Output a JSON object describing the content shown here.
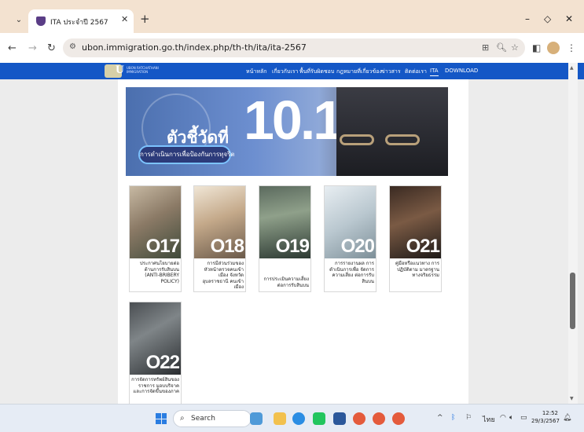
{
  "browser": {
    "tab_title": "ITA ประจำปี 2567",
    "url": "ubon.immigration.go.th/index.php/th-th/ita/ita-2567"
  },
  "site": {
    "logo_letter": "U",
    "logo_text": "UBON RATCHATHANI IMMIGRATION",
    "nav": [
      "หน้าหลัก",
      "เกี่ยวกับเรา",
      "พื้นที่รับผิดชอบ",
      "กฎหมายที่เกี่ยวข้อง",
      "ข่าวสาร",
      "ติดต่อเรา",
      "ITA",
      "DOWNLOAD"
    ]
  },
  "banner": {
    "heading": "ตัวชี้วัดที่",
    "number": "10.1",
    "pill": "การดำเนินการเพื่อป้องกันการทุจริต"
  },
  "cards": [
    {
      "code": "O17",
      "caption": "ประกาศนโยบายต่อ ต้านการรับสินบน (ANTI-BRIBERY POLICY)"
    },
    {
      "code": "O18",
      "caption": "การมีส่วนร่วมของ หัวหน้าตรวจคนเข้าเมือง จังหวัดอุบลราชธานี คนเข้าเมือง"
    },
    {
      "code": "O19",
      "caption": "การประเมินความเสี่ยง ต่อการรับสินบน"
    },
    {
      "code": "O20",
      "caption": "การรายงานผล การดำเนินการเพื่อ จัดการความเสี่ยง ต่อการรับสินบน"
    },
    {
      "code": "O21",
      "caption": "คู่มือหรือแนวทาง การปฏิบัติตาม มาตรฐานทางจริยธรรม"
    },
    {
      "code": "O22",
      "caption": "การจัดการทรัพย์สินของ ราชการ มอบบริจาค และการจัดขึ้นของภาค"
    }
  ],
  "taskbar": {
    "search_placeholder": "Search",
    "lang": "ไทย",
    "time": "12:52",
    "date": "29/3/2567"
  }
}
